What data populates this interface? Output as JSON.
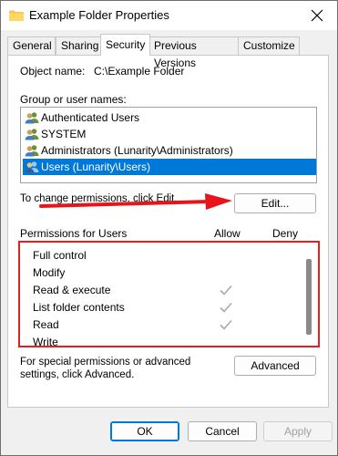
{
  "window": {
    "title": "Example Folder Properties",
    "icon": "folder-icon",
    "close": "close-icon"
  },
  "tabs": [
    {
      "label": "General"
    },
    {
      "label": "Sharing"
    },
    {
      "label": "Security",
      "active": true
    },
    {
      "label": "Previous Versions"
    },
    {
      "label": "Customize"
    }
  ],
  "security": {
    "object_name_label": "Object name:",
    "object_name_value": "C:\\Example Folder",
    "group_label": "Group or user names:",
    "groups": [
      {
        "label": "Authenticated Users",
        "icon": "users-icon"
      },
      {
        "label": "SYSTEM",
        "icon": "users-icon"
      },
      {
        "label": "Administrators (Lunarity\\Administrators)",
        "icon": "users-icon"
      },
      {
        "label": "Users (Lunarity\\Users)",
        "icon": "users-icon",
        "selected": true
      }
    ],
    "change_text": "To change permissions, click Edit.",
    "edit_label": "Edit...",
    "permissions_header": "Permissions for Users",
    "allow_header": "Allow",
    "deny_header": "Deny",
    "permissions": [
      {
        "name": "Full control",
        "allow": false,
        "deny": false
      },
      {
        "name": "Modify",
        "allow": false,
        "deny": false
      },
      {
        "name": "Read & execute",
        "allow": true,
        "deny": false
      },
      {
        "name": "List folder contents",
        "allow": true,
        "deny": false
      },
      {
        "name": "Read",
        "allow": true,
        "deny": false
      },
      {
        "name": "Write",
        "allow": false,
        "deny": false
      }
    ],
    "special_text": "For special permissions or advanced settings, click Advanced.",
    "advanced_label": "Advanced"
  },
  "footer": {
    "ok_label": "OK",
    "cancel_label": "Cancel",
    "apply_label": "Apply"
  },
  "colors": {
    "selection": "#0078d7",
    "highlight_box": "#e02020",
    "arrow": "#e8141b",
    "folder": "#f2c94c"
  }
}
